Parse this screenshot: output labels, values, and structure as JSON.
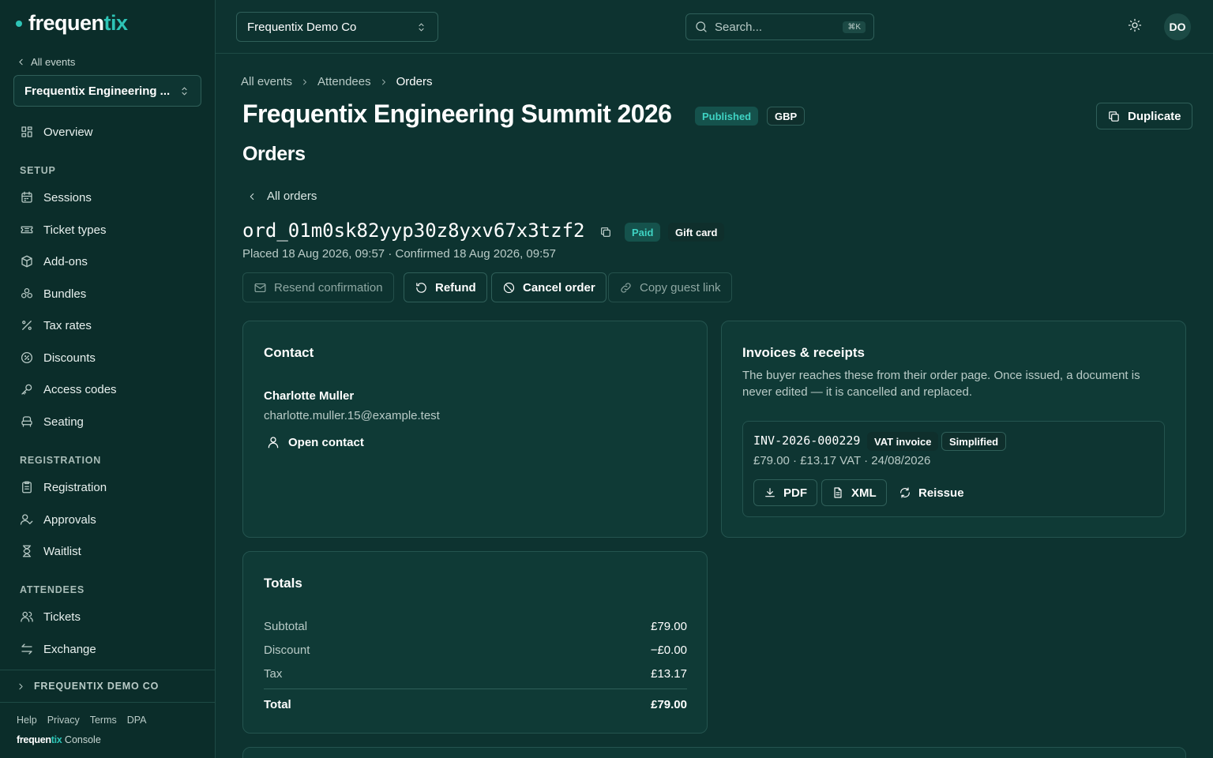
{
  "brand": {
    "name_a": "frequen",
    "name_b": "tix",
    "accent": "#2ec4b6"
  },
  "sidebar": {
    "back_label": "All events",
    "event_select": "Frequentix Engineering ...",
    "overview": "Overview",
    "sections": {
      "setup": "SETUP",
      "registration": "REGISTRATION",
      "attendees": "ATTENDEES"
    },
    "setup_items": [
      "Sessions",
      "Ticket types",
      "Add-ons",
      "Bundles",
      "Tax rates",
      "Discounts",
      "Access codes",
      "Seating"
    ],
    "registration_items": [
      "Registration",
      "Approvals",
      "Waitlist"
    ],
    "attendee_items": [
      "Tickets",
      "Exchange"
    ],
    "org_row": "FREQUENTIX DEMO CO",
    "footer_links": [
      "Help",
      "Privacy",
      "Terms",
      "DPA"
    ],
    "footer_brand_a": "frequen",
    "footer_brand_b": "tix",
    "footer_console": "Console"
  },
  "topbar": {
    "org_select": "Frequentix Demo Co",
    "search_placeholder": "Search...",
    "search_kbd": "⌘K",
    "avatar": "DO"
  },
  "breadcrumb": [
    "All events",
    "Attendees",
    "Orders"
  ],
  "page": {
    "title": "Frequentix Engineering Summit 2026",
    "status_badge": "Published",
    "currency_badge": "GBP",
    "duplicate_label": "Duplicate",
    "section_title": "Orders",
    "all_orders": "All orders"
  },
  "order": {
    "id": "ord_01m0sk82yyp30z8yxv67x3tzf2",
    "status": "Paid",
    "payment_badge": "Gift card",
    "meta": "Placed 18 Aug 2026, 09:57 · Confirmed 18 Aug 2026, 09:57",
    "actions": {
      "resend": "Resend confirmation",
      "refund": "Refund",
      "cancel": "Cancel order",
      "copy_link": "Copy guest link"
    }
  },
  "contact": {
    "title": "Contact",
    "name": "Charlotte Muller",
    "email": "charlotte.muller.15@example.test",
    "open_label": "Open contact"
  },
  "invoices": {
    "title": "Invoices & receipts",
    "description": "The buyer reaches these from their order page. Once issued, a document is never edited — it is cancelled and replaced.",
    "item": {
      "number": "INV-2026-000229",
      "type_badge": "VAT invoice",
      "kind_badge": "Simplified",
      "meta": "£79.00 · £13.17 VAT · 24/08/2026",
      "pdf": "PDF",
      "xml": "XML",
      "reissue": "Reissue"
    }
  },
  "totals": {
    "title": "Totals",
    "rows": [
      {
        "label": "Subtotal",
        "value": "£79.00"
      },
      {
        "label": "Discount",
        "value": "−£0.00"
      },
      {
        "label": "Tax",
        "value": "£13.17"
      }
    ],
    "total_label": "Total",
    "total_value": "£79.00"
  }
}
